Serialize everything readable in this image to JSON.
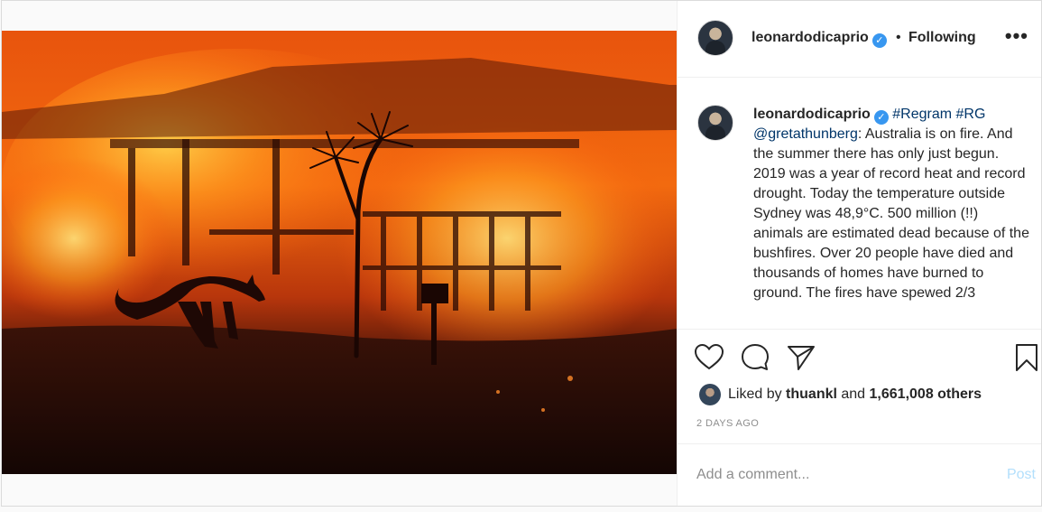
{
  "colors": {
    "verified_badge": "#3897f0",
    "hashtag": "#003569",
    "post_button_disabled": "#b2dffc",
    "meta_grey": "#8e8e8e"
  },
  "header": {
    "username": "leonardodicaprio",
    "separator": "•",
    "follow_status": "Following",
    "more_label": "•••",
    "avatar_icon": "profile-avatar"
  },
  "caption": {
    "username": "leonardodicaprio",
    "tags": "#Regram #RG",
    "mention": "@gretathunberg",
    "text": ": Australia is on fire. And the summer there has only just begun. 2019 was a year of record heat and record drought. Today the temperature outside Sydney was 48,9°C. 500 million (!!) animals are estimated dead because of the bushfires. Over 20 people have died and thousands of homes have burned to ground. The fires have spewed 2/3"
  },
  "actions": {
    "like_icon": "heart-icon",
    "comment_icon": "comment-icon",
    "share_icon": "share-icon",
    "save_icon": "bookmark-icon"
  },
  "likes": {
    "prefix": "Liked by ",
    "user": "thuankl",
    "middle": " and ",
    "count": "1,661,008 others"
  },
  "timestamp": "2 DAYS AGO",
  "comment_box": {
    "placeholder": "Add a comment...",
    "post_label": "Post"
  }
}
